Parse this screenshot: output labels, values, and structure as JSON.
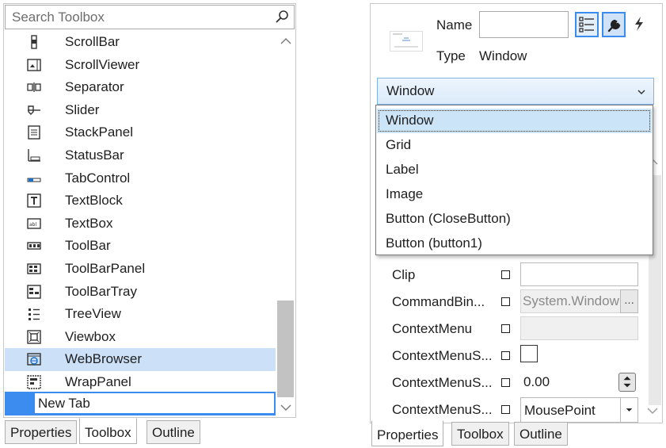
{
  "toolbox": {
    "search_placeholder": "Search Toolbox",
    "items": [
      {
        "label": "ScrollBar",
        "icon": "scrollbar-icon"
      },
      {
        "label": "ScrollViewer",
        "icon": "scrollviewer-icon"
      },
      {
        "label": "Separator",
        "icon": "separator-icon"
      },
      {
        "label": "Slider",
        "icon": "slider-icon"
      },
      {
        "label": "StackPanel",
        "icon": "stackpanel-icon"
      },
      {
        "label": "StatusBar",
        "icon": "statusbar-icon"
      },
      {
        "label": "TabControl",
        "icon": "tabcontrol-icon"
      },
      {
        "label": "TextBlock",
        "icon": "textblock-icon"
      },
      {
        "label": "TextBox",
        "icon": "textbox-icon"
      },
      {
        "label": "ToolBar",
        "icon": "toolbar-icon"
      },
      {
        "label": "ToolBarPanel",
        "icon": "toolbarpanel-icon"
      },
      {
        "label": "ToolBarTray",
        "icon": "toolbartray-icon"
      },
      {
        "label": "TreeView",
        "icon": "treeview-icon"
      },
      {
        "label": "Viewbox",
        "icon": "viewbox-icon"
      },
      {
        "label": "WebBrowser",
        "icon": "webbrowser-icon",
        "selected": true
      },
      {
        "label": "WrapPanel",
        "icon": "wrappanel-icon"
      }
    ],
    "new_tab_value": "New Tab",
    "tabs": [
      "Properties",
      "Toolbox",
      "Outline"
    ],
    "active_tab": "Toolbox"
  },
  "properties": {
    "name_label": "Name",
    "name_value": "",
    "type_label": "Type",
    "type_value": "Window",
    "selected_element": "Window",
    "dropdown_items": [
      "Window",
      "Grid",
      "Label",
      "Image",
      "Button (CloseButton)",
      "Button (button1)"
    ],
    "dropdown_selected": "Window",
    "rows": [
      {
        "name": "Clip",
        "value": ""
      },
      {
        "name": "CommandBin...",
        "value": "System.Window",
        "ellipsis": "..."
      },
      {
        "name": "ContextMenu",
        "value": ""
      },
      {
        "name": "ContextMenuS...",
        "value": ""
      },
      {
        "name": "ContextMenuS...",
        "value": "0.00"
      },
      {
        "name": "ContextMenuS...",
        "value": "MousePoint"
      }
    ],
    "tabs": [
      "Properties",
      "Toolbox",
      "Outline"
    ],
    "active_tab": "Properties"
  },
  "colors": {
    "accent": "#3c8cf0",
    "selection": "#cce0f7"
  }
}
